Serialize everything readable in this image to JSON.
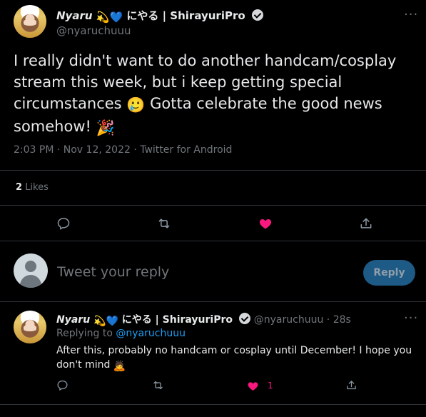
{
  "main_tweet": {
    "display_name": "Nyaru",
    "name_emoji_1": "💫",
    "name_emoji_2": "💙",
    "name_suffix": "にやる | ShirayuriPro",
    "handle": "@nyaruchuuu",
    "text_line1": "I really didn't want to do another handcam/cosplay",
    "text_line2": "stream this week, but i keep getting special",
    "text_line3a": "circumstances",
    "text_emoji_1": "🥲",
    "text_line3b": "Gotta celebrate the good news",
    "text_line4": "somehow!",
    "text_emoji_2": "🎉",
    "meta": "2:03 PM · Nov 12, 2022 · Twitter for Android",
    "likes_count": "2",
    "likes_label": "Likes"
  },
  "compose": {
    "placeholder": "Tweet your reply",
    "reply_button": "Reply"
  },
  "reply_tweet": {
    "display_name": "Nyaru",
    "name_emoji_1": "💫",
    "name_emoji_2": "💙",
    "name_suffix": "にやる | ShirayuriPro",
    "handle": "@nyaruchuuu",
    "sep": "·",
    "time": "28s",
    "replying_prefix": "Replying to",
    "replying_to": "@nyaruchuuu",
    "text_line1": "After this, probably no handcam or cosplay until December! I hope you",
    "text_line2": "don't mind",
    "text_emoji": "🙇",
    "like_count": "1"
  },
  "colors": {
    "background": "#000000",
    "text": "#e7e9ea",
    "muted": "#71767b",
    "link": "#1d9bf0",
    "like": "#f91880",
    "reply_button_bg": "#1d5a86"
  }
}
